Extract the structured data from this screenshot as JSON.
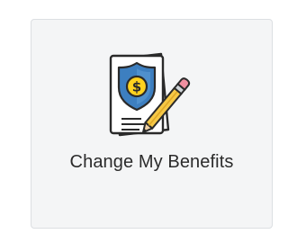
{
  "tile": {
    "label": "Change My Benefits",
    "icon": "benefits-document-shield-pencil-icon",
    "colors": {
      "shield_blue": "#3d7fc0",
      "coin_yellow": "#ffd21f",
      "pencil_yellow": "#f6c846",
      "eraser_pink": "#ef8fa0",
      "outline": "#2a2a2a"
    }
  }
}
